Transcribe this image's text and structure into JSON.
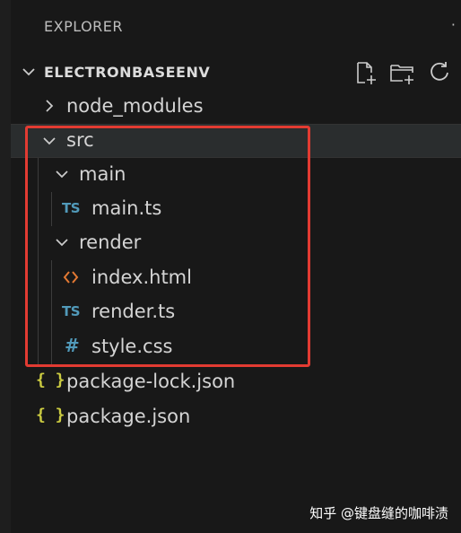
{
  "explorer": {
    "title": "EXPLORER",
    "more": "·"
  },
  "section": {
    "title": "ELECTRONBASEENV",
    "actions": [
      "new-file-icon",
      "new-folder-icon",
      "refresh-icon"
    ]
  },
  "tree": {
    "node_modules": "node_modules",
    "src": "src",
    "main": "main",
    "main_ts": "main.ts",
    "render": "render",
    "index_html": "index.html",
    "render_ts": "render.ts",
    "style_css": "style.css",
    "package_lock": "package-lock.json",
    "package_json": "package.json"
  },
  "icons": {
    "ts_label": "TS",
    "css_label": "#",
    "json_label": "{ }"
  },
  "colors": {
    "background": "#181818",
    "text": "#d4d4d4",
    "ts_blue": "#519aba",
    "json_yellow": "#cbcb41",
    "html_orange": "#e37933",
    "highlight": "#e23b32"
  },
  "watermark": "知乎 @键盘缝的咖啡渍"
}
